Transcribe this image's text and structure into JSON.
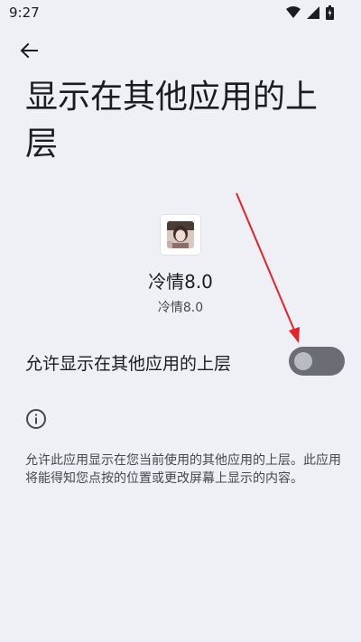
{
  "status_bar": {
    "time": "9:27",
    "icons": [
      "wifi-icon",
      "cellular-signal-icon",
      "battery-icon"
    ]
  },
  "header": {
    "back_icon": "arrow-back-icon",
    "title": "显示在其他应用的上层"
  },
  "app": {
    "name": "冷情8.0",
    "version": "冷情8.0",
    "icon": "app-icon"
  },
  "setting": {
    "label": "允许显示在其他应用的上层",
    "enabled": false
  },
  "info": {
    "icon": "info-icon",
    "description": "允许此应用显示在您当前使用的其他应用的上层。此应用将能得知您点按的位置或更改屏幕上显示的内容。"
  },
  "colors": {
    "background": "#eef0f6",
    "switch_track_off": "#6a6d74",
    "switch_thumb_off": "#b8bbc2",
    "annotation_arrow": "#e3222a"
  }
}
